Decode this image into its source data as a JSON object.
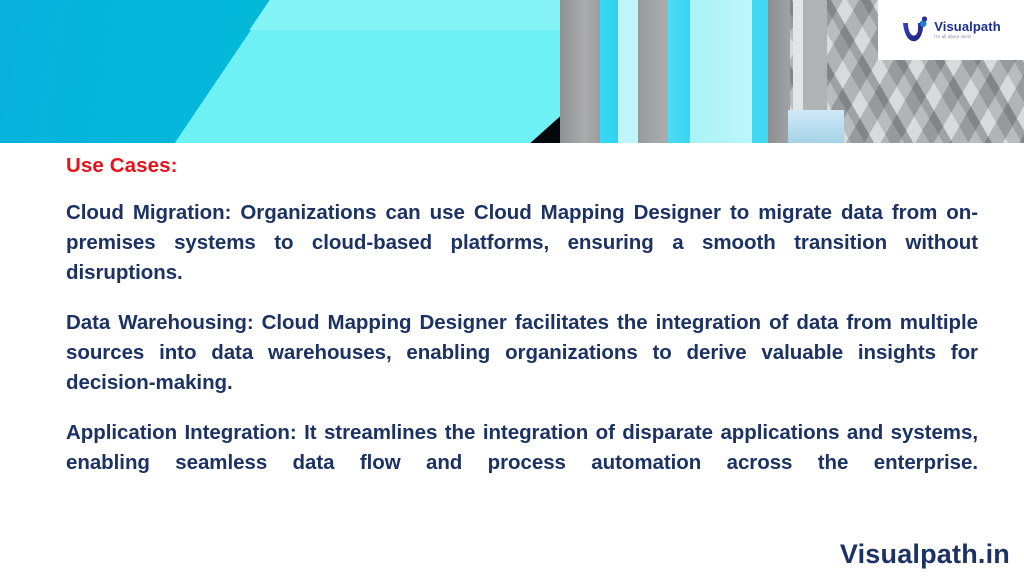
{
  "slide": {
    "heading": "Use Cases:",
    "heading_color": "#e8121a",
    "body_color": "#1b3263",
    "paragraphs": [
      "Cloud Migration: Organizations can use Cloud Mapping Designer to migrate data from on-premises systems to cloud-based platforms, ensuring a smooth transition without disruptions.",
      "Data Warehousing: Cloud Mapping Designer facilitates the integration of data from multiple sources into data warehouses, enabling organizations to derive valuable insights for decision-making.",
      "Application Integration: It streamlines the integration of disparate applications and systems, enabling seamless data flow and process automation across the enterprise."
    ],
    "footer_brand": "Visualpath.in"
  },
  "banner": {
    "logo": {
      "name": "Visualpath",
      "tagline": "It's all about skills",
      "mark_color": "#2b2f96",
      "accent_color": "#1f7fd6"
    },
    "colors": {
      "cyan": "#03bdd8",
      "light_cyan": "#84f4f6",
      "gray": "#a9abac",
      "dark": "#05070c"
    }
  }
}
